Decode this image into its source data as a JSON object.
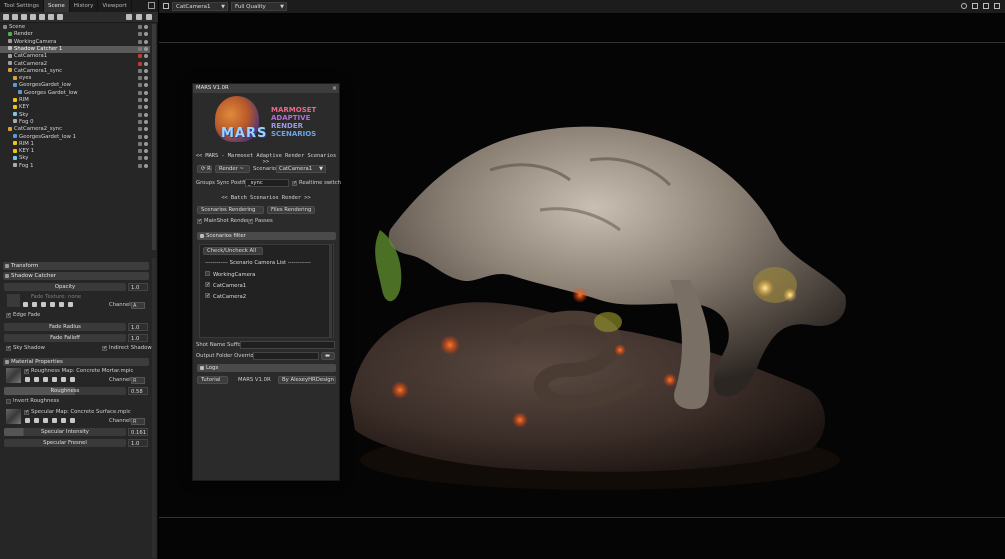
{
  "left_panel": {
    "tabs": [
      "Tool Settings",
      "Scene",
      "History",
      "Viewport"
    ],
    "active_tab": "Scene",
    "scene_tree": [
      {
        "label": "Scene",
        "depth": 0,
        "icon": "scene-icon"
      },
      {
        "label": "Render",
        "depth": 1,
        "icon": "render-icon"
      },
      {
        "label": "WorkingCamera",
        "depth": 1,
        "icon": "camera-icon"
      },
      {
        "label": "Shadow Catcher 1",
        "depth": 1,
        "icon": "shadow-catcher-icon",
        "selected": true
      },
      {
        "label": "CatCamera1",
        "depth": 1,
        "icon": "camera-icon",
        "red_lock": true
      },
      {
        "label": "CatCamera2",
        "depth": 1,
        "icon": "camera-icon",
        "red_lock": true
      },
      {
        "label": "CatCamera1_sync",
        "depth": 1,
        "icon": "folder-icon"
      },
      {
        "label": "eyes",
        "depth": 2,
        "icon": "folder-icon"
      },
      {
        "label": "GeorgesGardet_low",
        "depth": 2,
        "icon": "mesh-icon"
      },
      {
        "label": "Georges Gardet_low",
        "depth": 3,
        "icon": "mesh-icon"
      },
      {
        "label": "RIM",
        "depth": 2,
        "icon": "light-icon"
      },
      {
        "label": "KEY",
        "depth": 2,
        "icon": "light-icon"
      },
      {
        "label": "Sky",
        "depth": 2,
        "icon": "sky-icon"
      },
      {
        "label": "Fog 0",
        "depth": 2,
        "icon": "fog-icon"
      },
      {
        "label": "CatCamera2_sync",
        "depth": 1,
        "icon": "folder-icon"
      },
      {
        "label": "GeorgesGardet_low 1",
        "depth": 2,
        "icon": "mesh-icon"
      },
      {
        "label": "RIM 1",
        "depth": 2,
        "icon": "light-icon"
      },
      {
        "label": "KEY 1",
        "depth": 2,
        "icon": "light-icon"
      },
      {
        "label": "Sky",
        "depth": 2,
        "icon": "sky-icon"
      },
      {
        "label": "Fog 1",
        "depth": 2,
        "icon": "fog-icon"
      }
    ],
    "properties": {
      "transform_label": "Transform",
      "shadow_catcher_label": "Shadow Catcher",
      "opacity_label": "Opacity",
      "opacity_value": "1.0",
      "fade_texture_label": "Fade Texture: none",
      "channel_label": "Channel",
      "channel_value": "A",
      "edge_fade_label": "Edge Fade",
      "fade_radius_label": "Fade Radius",
      "fade_radius_value": "1.0",
      "fade_falloff_label": "Fade Falloff",
      "fade_falloff_value": "1.0",
      "sky_shadow_label": "Sky Shadow",
      "indirect_shadow_label": "Indirect Shadow",
      "material_properties_label": "Material Properties",
      "roughness_map_label": "Roughness Map: Concrete Mortar.mpic",
      "roughness_channel_value": "R",
      "roughness_label": "Roughness",
      "roughness_value": "0.58",
      "invert_roughness_label": "Invert Roughness",
      "specular_map_label": "Specular Map: Concrete Surface.mpic",
      "specular_channel_value": "R",
      "specular_intensity_label": "Specular Intensity",
      "specular_intensity_value": "0.161",
      "specular_fresnel_label": "Specular Fresnel",
      "specular_fresnel_value": "1.0"
    }
  },
  "viewport": {
    "camera_select": "CatCamera1",
    "quality_select": "Full Quality"
  },
  "mars": {
    "title": "MARS V1.0R",
    "logo_text": "MARS",
    "logo_line1": "MARMOSET",
    "logo_line2": "ADAPTIVE",
    "logo_line3": "RENDER",
    "logo_line4": "SCENARIOS",
    "header1": "<< MARS - Marmoset Adaptive Render Scenarios >>",
    "refresh_label": "R",
    "render_label": "Render ~",
    "scenario_label": "Scenario:",
    "scenario_value": "CatCamera1",
    "groups_sync_label": "Groups Sync Postfix:",
    "groups_sync_value": "_sync",
    "realtime_switch_label": "Realtime switch",
    "header2": "<< Batch Scenarios Render >>",
    "scenarios_rendering_label": "Scenarios Rendering",
    "files_rendering_label": "Files Rendering",
    "mainshot_render_label": "MainShot Render",
    "passes_label": "Passes",
    "scenarios_filter_label": "Scenarios filter",
    "check_uncheck_label": "Check/Uncheck All",
    "camera_list_header": "------------ Scenario Camera List ------------",
    "cameras": [
      {
        "label": "WorkingCamera",
        "checked": false
      },
      {
        "label": "CatCamera1",
        "checked": true
      },
      {
        "label": "CatCamera2",
        "checked": true
      }
    ],
    "shot_name_suffix_label": "Shot Name Suffix:",
    "output_folder_label": "Output Folder Override",
    "logs_label": "Logs",
    "tutorial_label": "Tutorial",
    "version_label": "MARS V1.0R",
    "author_label": "By AlexeyHRDesign"
  },
  "colors": {
    "panel_bg": "#262626",
    "selected_row": "#5a5a5a",
    "viewport_bg": "#050505",
    "lock_red": "#c0392b"
  }
}
